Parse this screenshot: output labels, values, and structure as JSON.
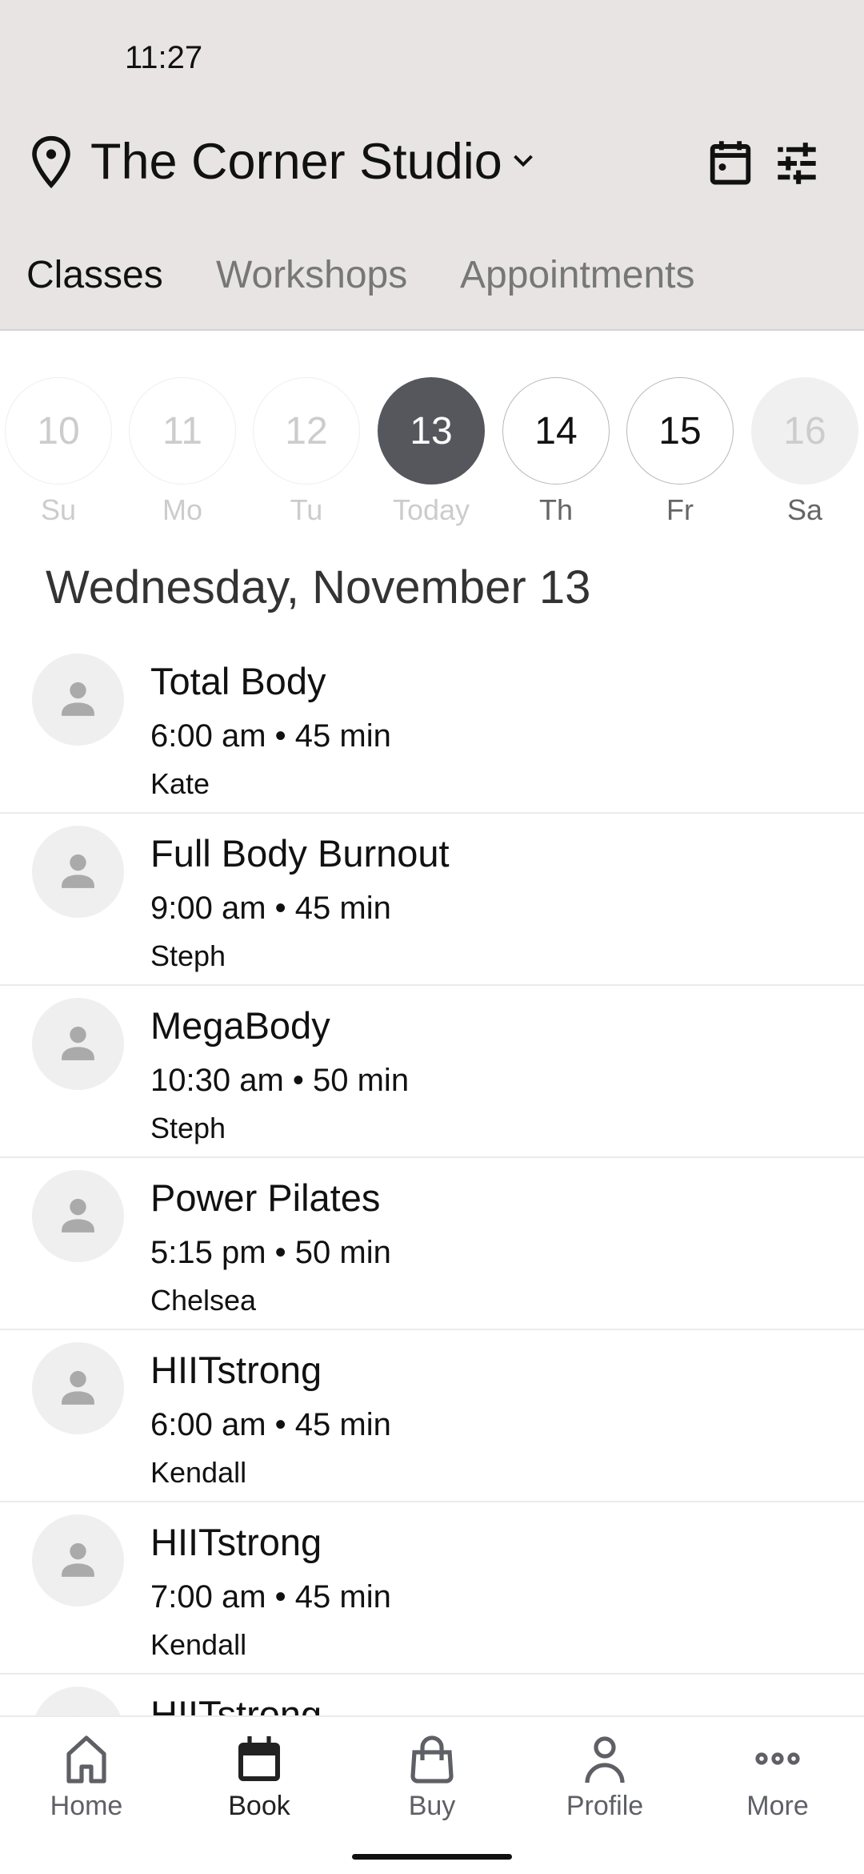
{
  "status_bar": {
    "time": "11:27"
  },
  "header": {
    "studio_name": "The Corner Studio",
    "icons": [
      "map-pin-icon",
      "chevron-down-icon",
      "calendar-icon",
      "filter-sliders-icon"
    ]
  },
  "tabs": [
    {
      "label": "Classes",
      "active": true
    },
    {
      "label": "Workshops",
      "active": false
    },
    {
      "label": "Appointments",
      "active": false
    }
  ],
  "week": [
    {
      "date": "10",
      "day": "Su",
      "state": "past"
    },
    {
      "date": "11",
      "day": "Mo",
      "state": "past"
    },
    {
      "date": "12",
      "day": "Tu",
      "state": "past"
    },
    {
      "date": "13",
      "day": "Today",
      "state": "selected"
    },
    {
      "date": "14",
      "day": "Th",
      "state": "available"
    },
    {
      "date": "15",
      "day": "Fr",
      "state": "available"
    },
    {
      "date": "16",
      "day": "Sa",
      "state": "unavailable"
    }
  ],
  "selected_date_heading": "Wednesday, November 13",
  "classes": [
    {
      "name": "Total Body",
      "time": "6:00 am • 45 min",
      "instructor": "Kate"
    },
    {
      "name": "Full Body Burnout",
      "time": "9:00 am • 45 min",
      "instructor": "Steph"
    },
    {
      "name": "MegaBody",
      "time": "10:30 am • 50 min",
      "instructor": "Steph"
    },
    {
      "name": "Power Pilates",
      "time": "5:15 pm • 50 min",
      "instructor": "Chelsea"
    },
    {
      "name": "HIITstrong",
      "time": "6:00 am • 45 min",
      "instructor": "Kendall"
    },
    {
      "name": "HIITstrong",
      "time": "7:00 am • 45 min",
      "instructor": "Kendall"
    },
    {
      "name": "HIITstrong"
    }
  ],
  "bottom_nav": [
    {
      "label": "Home",
      "icon": "home-icon"
    },
    {
      "label": "Book",
      "icon": "calendar-icon",
      "active": true
    },
    {
      "label": "Buy",
      "icon": "shopping-bag-icon"
    },
    {
      "label": "Profile",
      "icon": "person-icon"
    },
    {
      "label": "More",
      "icon": "more-dots-icon"
    }
  ],
  "colors": {
    "header_bg": "#e7e4e3",
    "selected_day": "#55575d",
    "avatar_bg": "#efefef"
  }
}
